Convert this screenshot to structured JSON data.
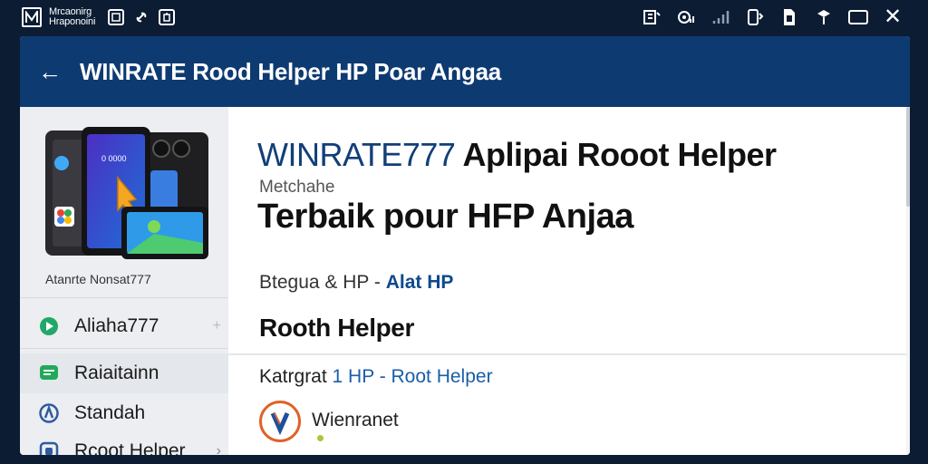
{
  "statusbar": {
    "brand_line1": "Mrcaonirg",
    "brand_line2": "Hraponoini",
    "icons": [
      "app-logo-icon",
      "screenshot-icon",
      "link-icon",
      "clipboard-icon",
      "notification-icon",
      "wifi-icon",
      "signal-icon",
      "nfc-icon",
      "sim-icon",
      "location-icon",
      "battery-icon",
      "close-icon"
    ]
  },
  "appbar": {
    "back_label": "←",
    "title": "WINRATE Rood Helper HP Poar Angaa"
  },
  "sidebar": {
    "phone_caption": "Atanrte Nonsat777",
    "items": [
      {
        "label": "Aliaha777",
        "icon": "play-icon"
      },
      {
        "label": "Raiaitainn",
        "icon": "chat-icon"
      },
      {
        "label": "Standah",
        "icon": "compass-icon"
      },
      {
        "label": "Rcoot Helper",
        "icon": "app-icon"
      }
    ],
    "chevron": "›",
    "plus": "+"
  },
  "content": {
    "heading_brand": "WINRATE777",
    "heading_rest": " Aplipai Rooot Helper",
    "meta": "Metchahe",
    "heading2": "Terbaik pour HFP Anjaa",
    "crumb_prefix": "Btegua & HP - ",
    "crumb_link": "Alat HP",
    "rh_title": "Rooth Helper",
    "cat_prefix": "Katrgrat ",
    "cat_link": "1 HP - Root Helper",
    "item_label": "Wienranet"
  },
  "colors": {
    "appbar": "#0e3a72",
    "brand_blue": "#123f78",
    "link_blue": "#0d4a8c",
    "accent_orange": "#e0622a"
  }
}
